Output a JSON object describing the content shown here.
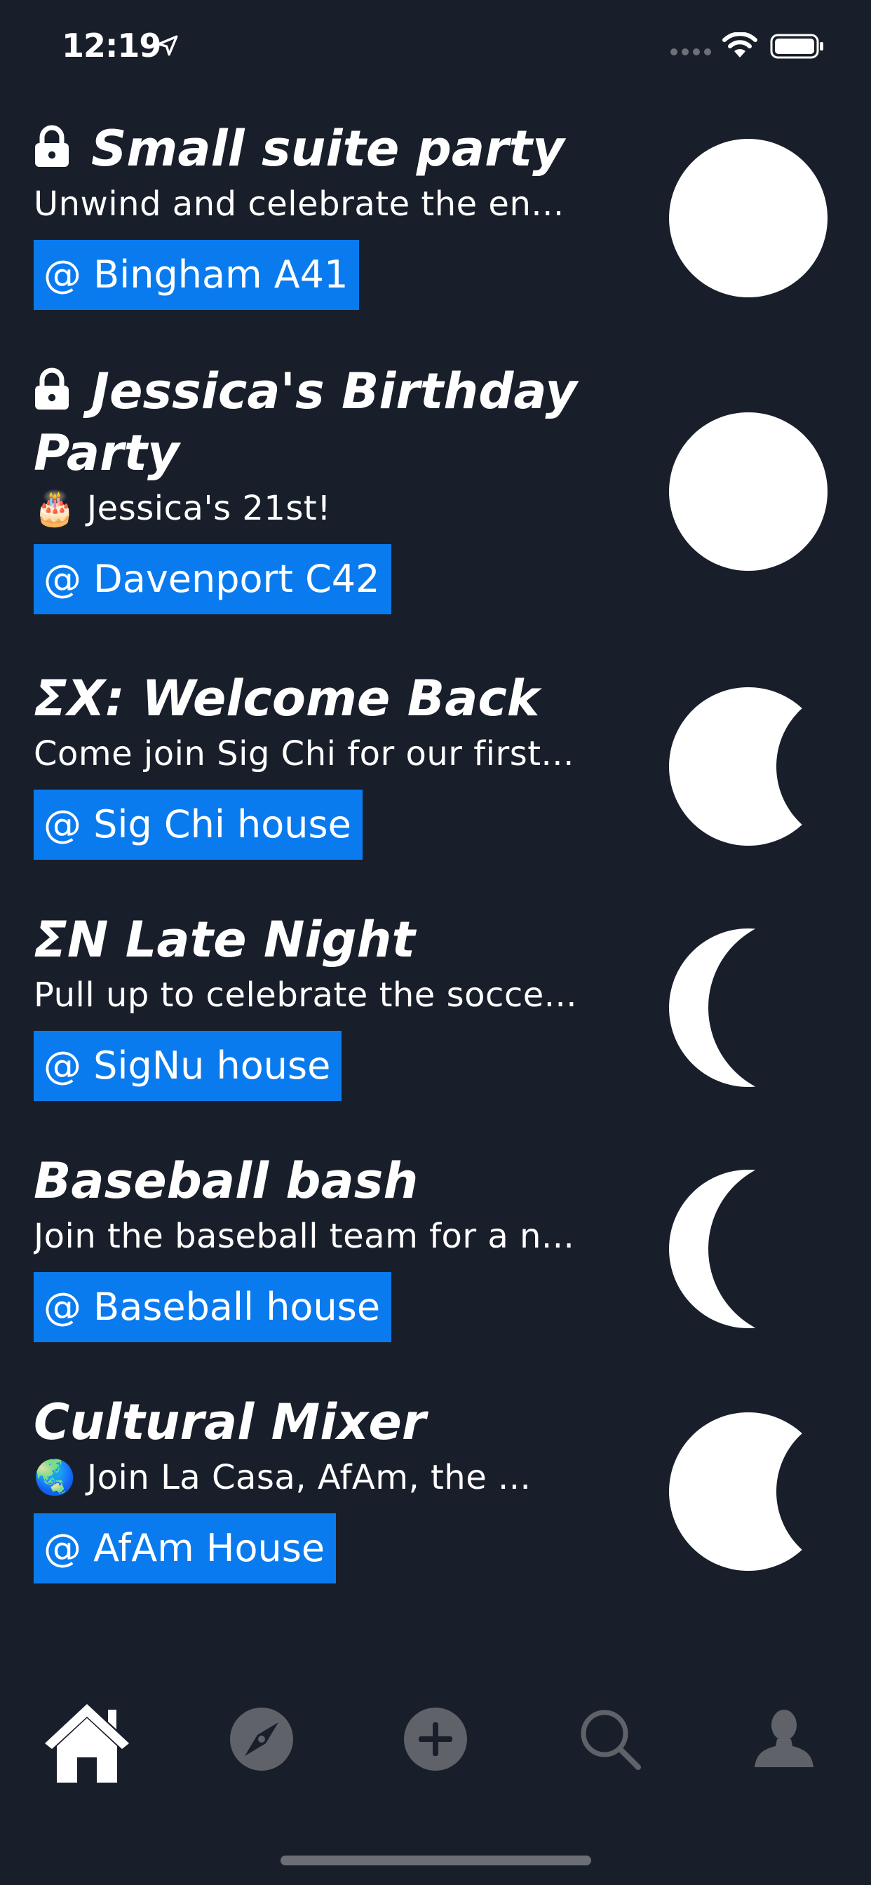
{
  "status_bar": {
    "time": "12:19",
    "icons": [
      "location-arrow-icon",
      "cellular-dots-icon",
      "wifi-icon",
      "battery-icon"
    ]
  },
  "events": [
    {
      "title": "Small suite party",
      "locked": true,
      "description": "Unwind and celebrate the en...",
      "location": "@ Bingham A41",
      "moon_phase": "full-moon-icon"
    },
    {
      "title": "Jessica's Birthday Party",
      "locked": true,
      "description": "🎂 Jessica's 21st!",
      "location": "@ Davenport C42",
      "moon_phase": "full-moon-icon"
    },
    {
      "title": "ΣΧ: Welcome Back",
      "locked": false,
      "description": "Come join Sig Chi for our first...",
      "location": "@ Sig Chi house",
      "moon_phase": "gibbous-moon-icon"
    },
    {
      "title": "ΣΝ Late Night",
      "locked": false,
      "description": "Pull up to celebrate the socce...",
      "location": "@ SigNu house",
      "moon_phase": "crescent-moon-icon"
    },
    {
      "title": "Baseball bash",
      "locked": false,
      "description": "Join the baseball team for a n...",
      "location": "@ Baseball house",
      "moon_phase": "crescent-moon-icon"
    },
    {
      "title": "Cultural Mixer",
      "locked": false,
      "description": "🌏 Join La Casa, AfAm, the ...",
      "location": "@ AfAm House",
      "moon_phase": "gibbous-moon-icon"
    }
  ],
  "tab_bar": {
    "tabs": [
      {
        "icon": "home-icon",
        "active": true
      },
      {
        "icon": "compass-icon",
        "active": false
      },
      {
        "icon": "add-circle-icon",
        "active": false
      },
      {
        "icon": "search-icon",
        "active": false
      },
      {
        "icon": "profile-icon",
        "active": false
      }
    ]
  },
  "colors": {
    "background": "#191f2a",
    "location_tag": "#0a7bef",
    "text": "#ffffff",
    "inactive_icon": "#5f6269"
  }
}
